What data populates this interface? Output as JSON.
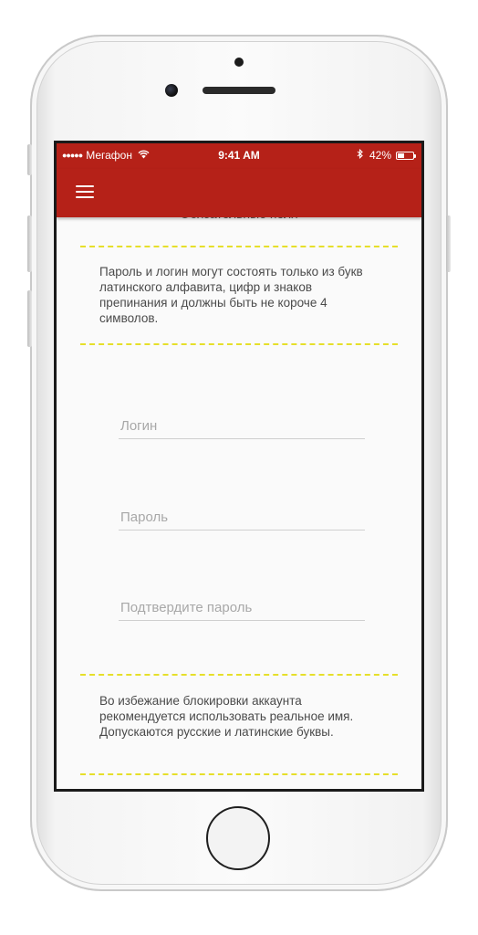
{
  "status_bar": {
    "signal": "●●●●●",
    "carrier": "Мегафон",
    "time": "9:41 AM",
    "battery_percent": "42%",
    "battery_level": 0.42
  },
  "app_bar": {
    "menu_icon": "hamburger-menu-icon",
    "color": "#b52118"
  },
  "section": {
    "heading": "Обязательные поля"
  },
  "login_rules": "Пароль и логин могут состоять только из букв латинского алфавита, цифр и знаков препинания и должны быть не короче 4 символов.",
  "form": {
    "login_placeholder": "Логин",
    "password_placeholder": "Пароль",
    "confirm_placeholder": "Подтвердите пароль"
  },
  "name_hint": "Во избежание блокировки аккаунта рекомендуется использовать реальное имя. Допускаются русские и латинские буквы.",
  "colors": {
    "accent": "#b52118",
    "divider": "#e6df2a"
  }
}
